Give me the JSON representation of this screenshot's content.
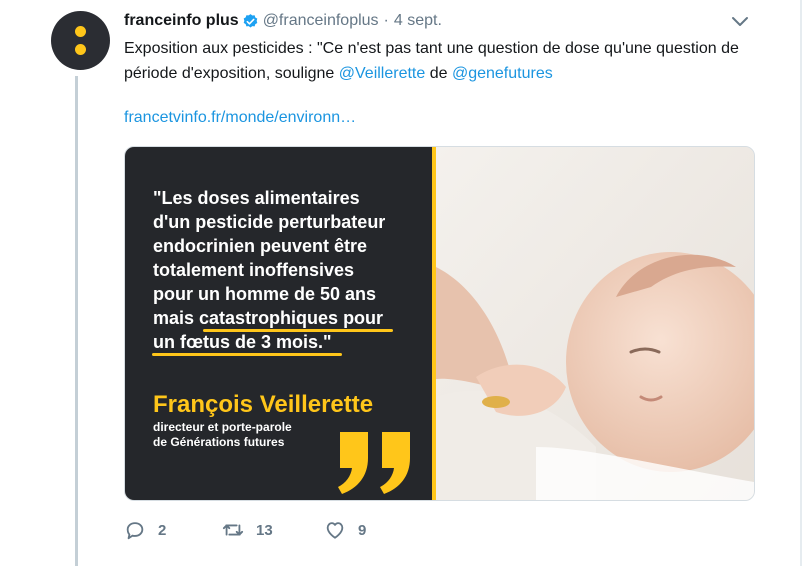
{
  "tweet": {
    "account_name": "franceinfo plus",
    "handle": "@franceinfoplus",
    "separator": "·",
    "date": "4 sept.",
    "text_parts": {
      "intro": "Exposition aux pesticides : \"Ce n'est pas tant une question de dose qu'une question de période d'exposition, souligne ",
      "mention1": "@Veillerette",
      "middle": " de ",
      "mention2": "@genefutures"
    },
    "link": "francetvinfo.fr/monde/environn…"
  },
  "media": {
    "quote": "\"Les doses alimentaires\nd'un pesticide perturbateur\nendocrinien peuvent être\ntotalement inoffensives\npour un homme de 50 ans\nmais catastrophiques pour\nun fœtus de 3 mois.\"",
    "speaker": "François Veillerette",
    "role": "directeur et porte-parole\nde Générations futures"
  },
  "actions": {
    "replies": "2",
    "retweets": "13",
    "likes": "9"
  },
  "colors": {
    "link": "#1b95e0",
    "brand_yellow": "#ffc61a",
    "panel": "#25272b",
    "muted": "#657786"
  },
  "icons": [
    "verified-badge-icon",
    "chevron-down-icon",
    "reply-icon",
    "retweet-icon",
    "like-icon"
  ]
}
